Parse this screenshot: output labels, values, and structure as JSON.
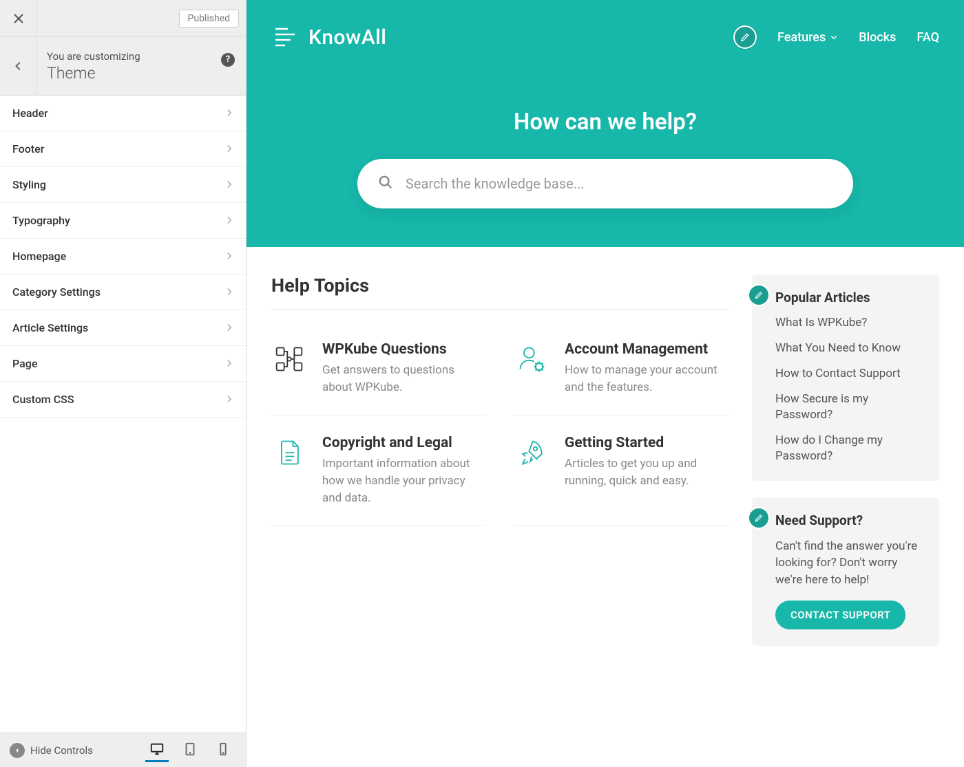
{
  "sidebar": {
    "publish_state": "Published",
    "customizing_label": "You are customizing",
    "theme_label": "Theme",
    "items": [
      {
        "label": "Header"
      },
      {
        "label": "Footer"
      },
      {
        "label": "Styling"
      },
      {
        "label": "Typography"
      },
      {
        "label": "Homepage"
      },
      {
        "label": "Category Settings"
      },
      {
        "label": "Article Settings"
      },
      {
        "label": "Page"
      },
      {
        "label": "Custom CSS"
      }
    ],
    "hide_controls": "Hide Controls"
  },
  "nav": {
    "brand": "KnowAll",
    "links": [
      {
        "label": "Features",
        "has_dropdown": true
      },
      {
        "label": "Blocks",
        "has_dropdown": false
      },
      {
        "label": "FAQ",
        "has_dropdown": false
      }
    ]
  },
  "hero": {
    "title": "How can we help?",
    "search_placeholder": "Search the knowledge base..."
  },
  "main": {
    "section_title": "Help Topics",
    "topics": [
      {
        "title": "WPKube Questions",
        "desc": "Get answers to questions about WPKube.",
        "icon": "diagram"
      },
      {
        "title": "Account Management",
        "desc": "How to manage your account and the features.",
        "icon": "user-gear"
      },
      {
        "title": "Copyright and Legal",
        "desc": "Important information about how we handle your privacy and data.",
        "icon": "document"
      },
      {
        "title": "Getting Started",
        "desc": "Articles to get you up and running, quick and easy.",
        "icon": "rocket"
      }
    ]
  },
  "widgets": {
    "popular": {
      "title": "Popular Articles",
      "items": [
        "What Is WPKube?",
        "What You Need to Know",
        "How to Contact Support",
        "How Secure is my Password?",
        "How do I Change my Password?"
      ]
    },
    "support": {
      "title": "Need Support?",
      "body": "Can't find the answer you're looking for? Don't worry we're here to help!",
      "cta": "CONTACT SUPPORT"
    }
  },
  "colors": {
    "accent": "#17b7a9"
  }
}
